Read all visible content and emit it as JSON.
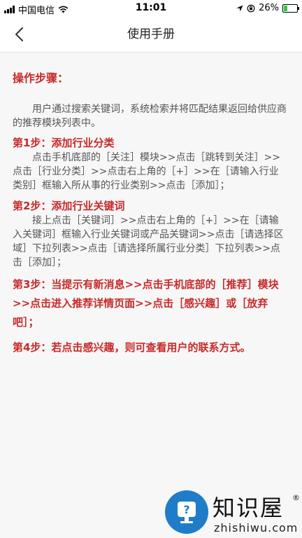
{
  "status_bar": {
    "carrier": "中国电信",
    "time": "11:01",
    "battery_text": "26%",
    "battery_level": 0.26,
    "battery_color": "#2ecc40"
  },
  "nav": {
    "title": "使用手册",
    "back_icon": "chevron-left-icon"
  },
  "content": {
    "heading": "操作步骤：",
    "intro": "用户通过搜索关键词，系统检索并将匹配结果返回给供应商的推荐模块列表中。",
    "steps": [
      {
        "title": "第1步：添加行业分类",
        "text": "点击手机底部的［关注］模块>>点击［跳转到关注］>>点击［行业分类］>>点击右上角的［+］>>在［请输入行业类别］框输入所从事的行业类别>>点击［添加］；"
      },
      {
        "title": "第2步：添加行业关键词",
        "text": "接上点击［关键词］>>点击右上角的［+］>>在［请输入关键词］框输入行业关键词或产品关键词>>点击［请选择区域］下拉列表>>点击［请选择所属行业分类］下拉列表>>点击［添加］；"
      },
      {
        "title": "第3步：当提示有新消息>>点击手机底部的［推荐］模块>>点击进入推荐详情页面>>点击［感兴趣］或［放弃吧］；"
      },
      {
        "title": "第4步：若点击感兴趣，则可查看用户的联系方式。"
      }
    ]
  },
  "watermark": {
    "name": "知识屋",
    "reg": "®",
    "url": "zhishiwu.com",
    "color": "#1f7cc9"
  }
}
